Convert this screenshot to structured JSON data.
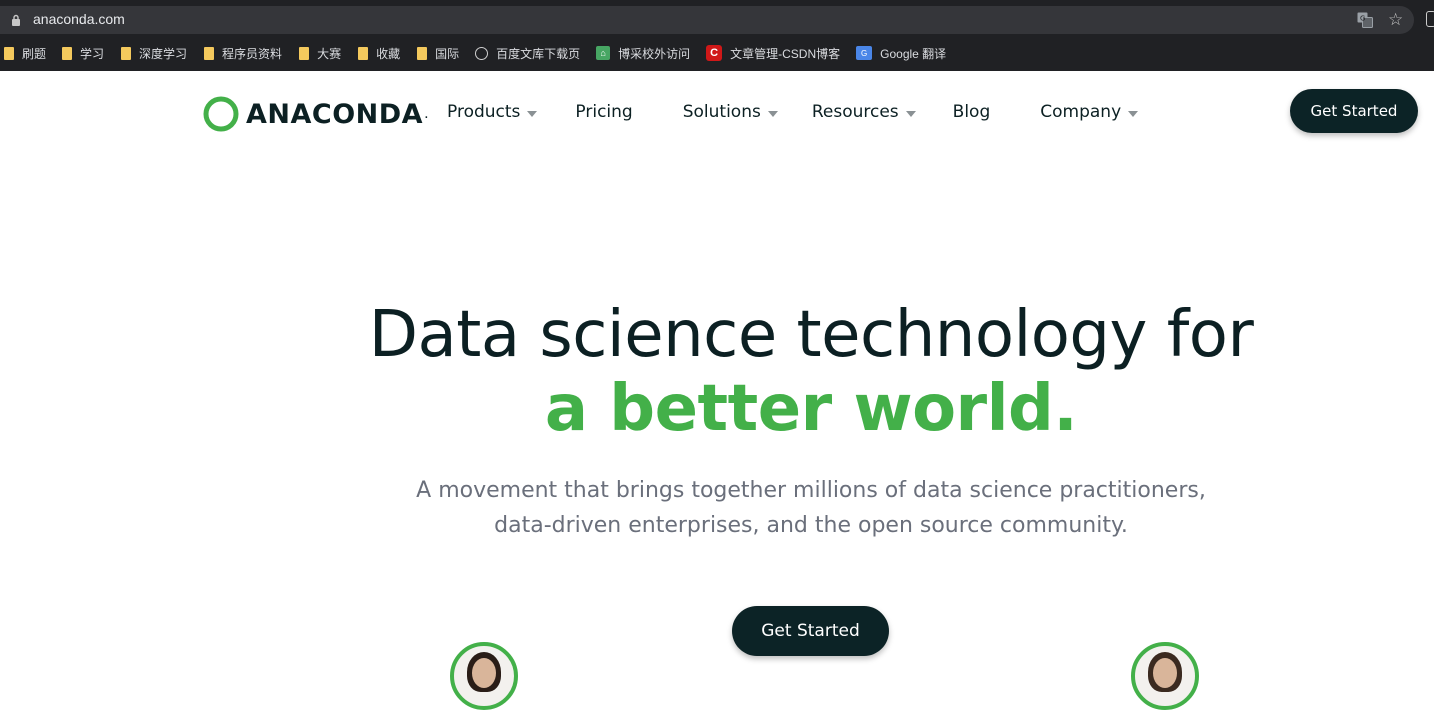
{
  "browser": {
    "url": "anaconda.com",
    "bookmarks": [
      {
        "label": "刷题",
        "icon": "folder-icon"
      },
      {
        "label": "学习",
        "icon": "folder-icon"
      },
      {
        "label": "深度学习",
        "icon": "folder-icon"
      },
      {
        "label": "程序员资料",
        "icon": "folder-icon"
      },
      {
        "label": "大赛",
        "icon": "folder-icon"
      },
      {
        "label": "收藏",
        "icon": "folder-icon"
      },
      {
        "label": "国际",
        "icon": "folder-icon"
      },
      {
        "label": "百度文库下载页",
        "icon": "globe-icon"
      },
      {
        "label": "博采校外访问",
        "icon": "bookmark-green-icon"
      },
      {
        "label": "文章管理-CSDN博客",
        "icon": "csdn-icon"
      },
      {
        "label": "Google 翻译",
        "icon": "google-translate-icon"
      }
    ]
  },
  "header": {
    "logo_text": "ANACONDA",
    "logo_dot": ".",
    "nav": [
      {
        "label": "Products",
        "dropdown": true
      },
      {
        "label": "Pricing",
        "dropdown": false
      },
      {
        "label": "Solutions",
        "dropdown": true
      },
      {
        "label": "Resources",
        "dropdown": true
      },
      {
        "label": "Blog",
        "dropdown": false
      },
      {
        "label": "Company",
        "dropdown": true
      }
    ],
    "cta_label": "Get Started"
  },
  "hero": {
    "title_line1": "Data science technology for",
    "title_line2": "a better world.",
    "subtitle_line1": "A movement that brings together millions of data science practitioners,",
    "subtitle_line2": "data-driven enterprises, and the open source community.",
    "cta_label": "Get Started"
  },
  "colors": {
    "brand_dark": "#0c2326",
    "brand_green": "#43b049",
    "chrome_bg": "#202124"
  }
}
